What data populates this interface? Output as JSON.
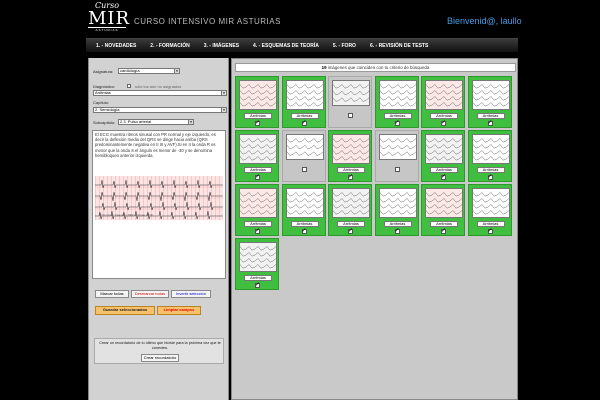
{
  "header": {
    "logo_script": "Curso",
    "logo_main": "MIR",
    "logo_sub": "ASTURIAS",
    "site_title": "CURSO INTENSIVO MIR ASTURIAS",
    "welcome": "Bienvenid@, laullo"
  },
  "nav": {
    "items": [
      "1. - NOVEDADES",
      "2. - FORMACIÓN",
      "3. - IMÁGENES",
      "4. - ESQUEMAS DE TEORÍA",
      "5. - FORO",
      "6. - REVISIÓN DE TESTS"
    ]
  },
  "filters": {
    "asignatura_label": "Asignatura:",
    "asignatura_value": "cardiología",
    "diagnostico_label": "Diagnóstico:",
    "solo_label": "sólo los aún no asignados",
    "diagnostico_value": "Arritmias",
    "capitulo_label": "Capítulo:",
    "capitulo_value": "2. Semiología",
    "subcapitulo_label": "Subcapítulo:",
    "subcapitulo_value": "2.3. Pulso arterial"
  },
  "description": {
    "text": "El ECG muestra ritmos sinusal con PR normal y eje izquierdo, es decir la deflexión media del QRS se dirige hacia arriba (QRS predominantemente negativa en II III y AVF).Si en II la onda R es menor que la onda S el ángulo es menor de -30 y se denomina hemibloqueo anterior izquierda.",
    "caption": "ECG Curso Intensivo MIR Asturias 2009"
  },
  "buttons": {
    "mark_all": "Marcar todas",
    "unmark_all": "Desmarcar todas",
    "invert": "Invertir selección",
    "save": "Guardar seleccionados",
    "clear": "Limpiar campos"
  },
  "reminder": {
    "text": "Crear un recordatorio de lo último que hiciste para la próxima vez que te conectes.",
    "button": "Crear recordatorio"
  },
  "results": {
    "count": "19",
    "text": "imágenes que coinciden con tu criterio de búsqueda"
  },
  "tiles": [
    {
      "label": "Arritmias",
      "checked": true
    },
    {
      "label": "Arritmias",
      "checked": true
    },
    {
      "label": "",
      "checked": false
    },
    {
      "label": "Arritmias",
      "checked": true
    },
    {
      "label": "Arritmias",
      "checked": true
    },
    {
      "label": "Arritmias",
      "checked": true
    },
    {
      "label": "Arritmias",
      "checked": true
    },
    {
      "label": "",
      "checked": false
    },
    {
      "label": "Arritmias",
      "checked": true
    },
    {
      "label": "",
      "checked": false
    },
    {
      "label": "Arritmias",
      "checked": true
    },
    {
      "label": "Arritmias",
      "checked": true
    },
    {
      "label": "Arritmias",
      "checked": true
    },
    {
      "label": "Arritmias",
      "checked": true
    },
    {
      "label": "Arritmias",
      "checked": true
    },
    {
      "label": "Arritmias",
      "checked": true
    },
    {
      "label": "Arritmias",
      "checked": true
    },
    {
      "label": "Arritmias",
      "checked": true
    },
    {
      "label": "Arritmias",
      "checked": true
    }
  ],
  "colors": {
    "accent_blue": "#3f9ee8",
    "tile_selected": "#3fbe3f",
    "tile_unselected": "#c6c6c6",
    "save_button": "#f7c26b"
  }
}
